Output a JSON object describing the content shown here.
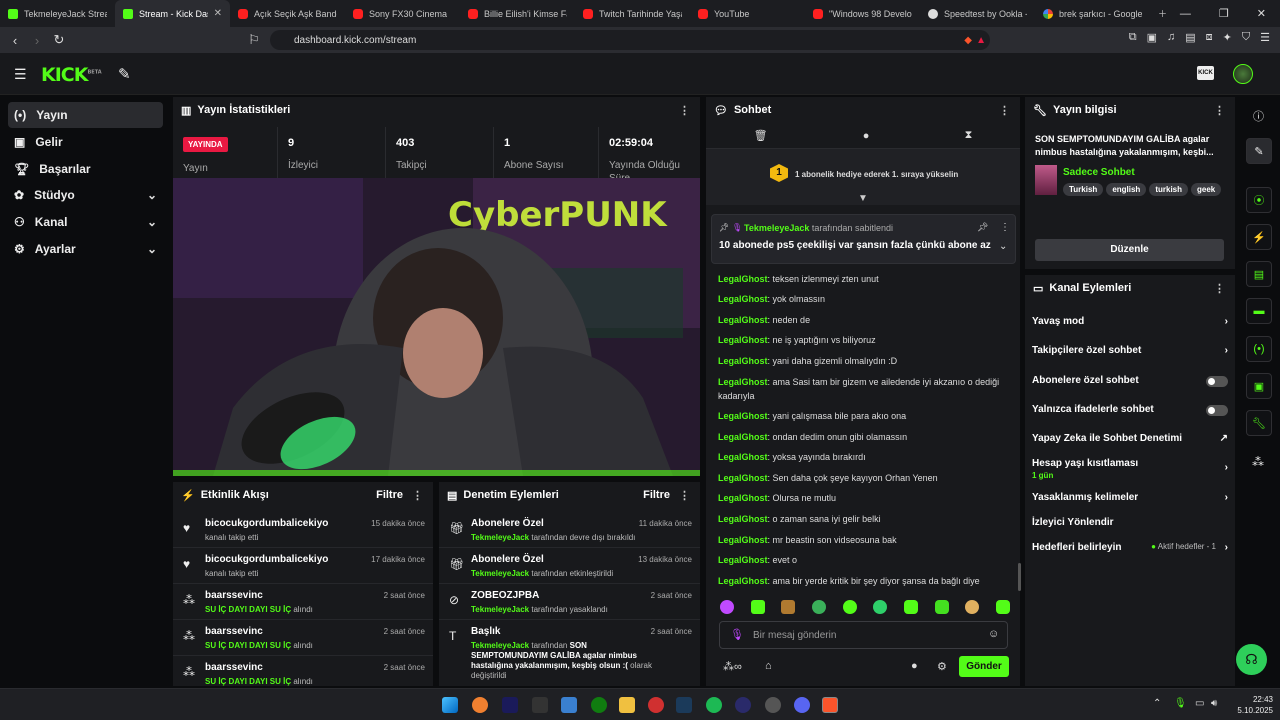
{
  "browser": {
    "tabs": [
      {
        "label": "TekmeleyeJack Stream",
        "fav": "kick"
      },
      {
        "label": "Stream - Kick Dash",
        "fav": "kick"
      },
      {
        "label": "Açık Seçik Aşk Bandosu",
        "fav": "yt"
      },
      {
        "label": "Sony FX30 Cinema",
        "fav": "yt"
      },
      {
        "label": "Billie Eilish'i Kimse Fark",
        "fav": "yt"
      },
      {
        "label": "Twitch Tarihinde Yaşanan",
        "fav": "yt"
      },
      {
        "label": "YouTube",
        "fav": "yt"
      },
      {
        "label": "\"Windows 98 Develop",
        "fav": "yt"
      },
      {
        "label": "Speedtest by Ookla - T",
        "fav": "gh"
      },
      {
        "label": "brek şarkıcı - Google'da",
        "fav": "g"
      }
    ],
    "url": "dashboard.kick.com/stream"
  },
  "sidebar": {
    "items": [
      "Yayın",
      "Gelir",
      "Başarılar",
      "Stüdyo",
      "Kanal",
      "Ayarlar"
    ]
  },
  "stats": {
    "title": "Yayın İstatistikleri",
    "live_badge": "YAYINDA",
    "live_label": "Yayın",
    "viewers": "9",
    "viewers_label": "İzleyici",
    "followers": "403",
    "followers_label": "Takipçi",
    "subs": "1",
    "subs_label": "Abone Sayısı",
    "duration": "02:59:04",
    "duration_label": "Yayında Olduğu Süre"
  },
  "activity": {
    "title": "Etkinlik Akışı",
    "filter": "Filtre",
    "items": [
      {
        "name": "bicocukgordumbalicekiyo",
        "sub": "kanalı takip etti",
        "time": "15 dakika önce"
      },
      {
        "name": "bicocukgordumbalicekiyo",
        "sub": "kanalı takip etti",
        "time": "17 dakika önce"
      },
      {
        "name": "baarssevinc",
        "sub_g": "SU İÇ DAYI DAYI SU İÇ",
        "sub": " alındı",
        "time": "2 saat önce"
      },
      {
        "name": "baarssevinc",
        "sub_g": "SU İÇ DAYI DAYI SU İÇ",
        "sub": " alındı",
        "time": "2 saat önce"
      },
      {
        "name": "baarssevinc",
        "sub_g": "SU İÇ DAYI DAYI SU İÇ",
        "sub": " alındı",
        "time": "2 saat önce"
      }
    ]
  },
  "moderation": {
    "title": "Denetim Eylemleri",
    "filter": "Filtre",
    "items": [
      {
        "name": "Abonelere Özel",
        "actor": "TekmeleyeJack",
        "sub": " tarafından devre dışı bırakıldı",
        "time": "11 dakika önce"
      },
      {
        "name": "Abonelere Özel",
        "actor": "TekmeleyeJack",
        "sub": " tarafından etkinleştirildi",
        "time": "13 dakika önce"
      },
      {
        "name": "ZOBEOZJPBA",
        "actor": "TekmeleyeJack",
        "sub": " tarafından yasaklandı",
        "time": "2 saat önce"
      },
      {
        "name": "Başlık",
        "actor": "TekmeleyeJack",
        "sub": " tarafından ",
        "bold": "SON SEMPTOMUNDAYIM GALİBA agalar nimbus hastalığına yakalanmışım, keşbiş olsun :(",
        "tail": " olarak değiştirildi",
        "time": "2 saat önce"
      }
    ]
  },
  "chat": {
    "title": "Sohbet",
    "gift_count": "1",
    "gift_text": "1 abonelik hediye ederek 1. sıraya yükselin",
    "pinned_by": "TekmeleyeJack",
    "pinned_suffix": "tarafından sabitlendi",
    "pinned_msg": "10 abonede ps5 çeekilişi var şansın fazla çünkü abone az",
    "messages": [
      {
        "u": "LegalGhost",
        "m": "teksen izlenmeyi zten unut"
      },
      {
        "u": "LegalGhost",
        "m": "yok olmassın"
      },
      {
        "u": "LegalGhost",
        "m": "neden de"
      },
      {
        "u": "LegalGhost",
        "m": "ne iş yaptığını vs biliyoruz"
      },
      {
        "u": "LegalGhost",
        "m": "yani daha gizemli olmalıydın :D"
      },
      {
        "u": "LegalGhost",
        "m": "ama Sasi tam bir gizem ve ailedende iyi akzanıo o dediği kadarıyla"
      },
      {
        "u": "LegalGhost",
        "m": "yani çalışmasa bile para akıo ona"
      },
      {
        "u": "LegalGhost",
        "m": "ondan dedim onun gibi olamassın"
      },
      {
        "u": "LegalGhost",
        "m": "yoksa yayında bırakırdı"
      },
      {
        "u": "LegalGhost",
        "m": "Sen daha çok şeye kayıyon Orhan Yenen"
      },
      {
        "u": "LegalGhost",
        "m": "Olursa ne mutlu"
      },
      {
        "u": "LegalGhost",
        "m": "o zaman sana iyi gelir belki"
      },
      {
        "u": "LegalGhost",
        "m": "mr beastin son vidseosuna bak"
      },
      {
        "u": "LegalGhost",
        "m": "evet o"
      },
      {
        "u": "LegalGhost",
        "m": "ama bir yerde kritik bir şey diyor şansa da bağlı diye"
      }
    ],
    "input_placeholder": "Bir mesaj gönderin",
    "send_label": "Gönder"
  },
  "info": {
    "title": "Yayın bilgisi",
    "stream_title": "SON SEMPTOMUNDAYIM GALİBA agalar nimbus hastalığına yakalanmışım, keşbi...",
    "category": "Sadece Sohbet",
    "tags": [
      "Turkish",
      "english",
      "turkish",
      "geek"
    ],
    "edit_label": "Düzenle"
  },
  "channel_actions": {
    "title": "Kanal Eylemleri",
    "slow": "Yavaş mod",
    "followers_only": "Takipçilere özel sohbet",
    "subs_only": "Abonelere özel sohbet",
    "emotes_only": "Yalnızca ifadelerle sohbet",
    "ai_mod": "Yapay Zeka ile Sohbet Denetimi",
    "age": "Hesap yaşı kısıtlaması",
    "age_value": "1 gün",
    "banned_words": "Yasaklanmış kelimeler",
    "redirect": "İzleyici Yönlendir",
    "goals": "Hedefleri belirleyin",
    "goals_status": "Aktif hedefler - 1"
  },
  "taskbar": {
    "time": "22:43",
    "date": "5.10.2025"
  }
}
